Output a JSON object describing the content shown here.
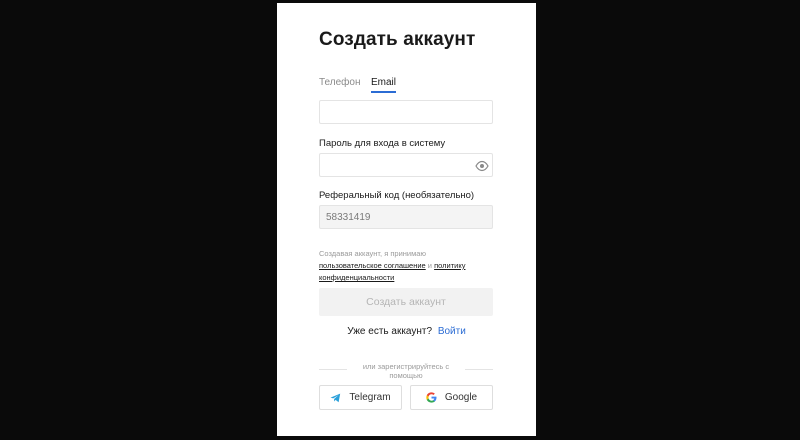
{
  "form": {
    "title": "Создать аккаунт",
    "tabs": [
      {
        "label": "Телефон",
        "active": false
      },
      {
        "label": "Email",
        "active": true
      }
    ],
    "email": {
      "value": "",
      "placeholder": ""
    },
    "password": {
      "label": "Пароль для входа в систему",
      "value": "",
      "icon": "eye-icon"
    },
    "referral": {
      "label": "Реферальный код (необязательно)",
      "value": "58331419"
    },
    "consent": {
      "prefix": "Создавая аккаунт, я принимаю",
      "agreement_link": "пользовательское соглашение",
      "conjunction": "и",
      "privacy_link": "политику конфиденциальности"
    },
    "submit_label": "Создать аккаунт",
    "login_prompt": "Уже есть аккаунт?",
    "login_link": "Войти",
    "divider_text": "или зарегистрируйтесь с помощью",
    "social": {
      "telegram": {
        "label": "Telegram",
        "icon": "telegram-icon"
      },
      "google": {
        "label": "Google",
        "icon": "google-icon"
      }
    }
  },
  "colors": {
    "background": "#0a0a0a",
    "panel": "#ffffff",
    "accent": "#2b6cd4",
    "telegram": "#2aa0da"
  }
}
